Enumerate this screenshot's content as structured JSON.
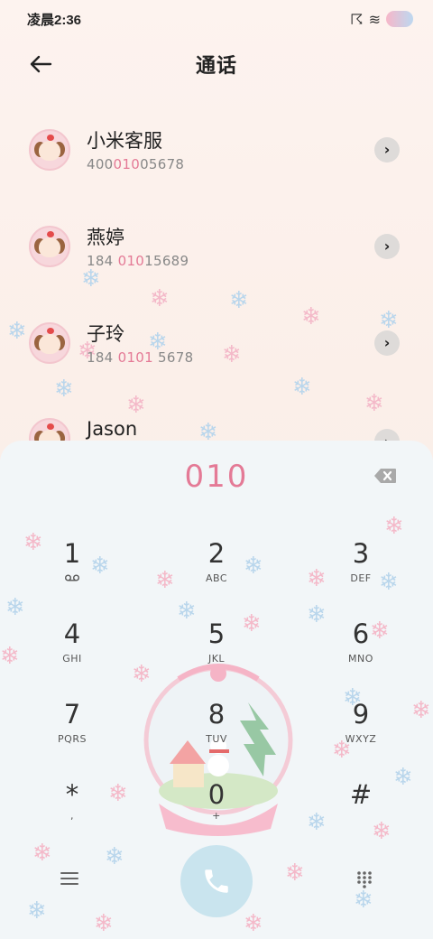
{
  "status_bar": {
    "time": "凌晨2:36"
  },
  "header": {
    "title": "通话",
    "back_icon": "arrow-left-icon"
  },
  "contacts": [
    {
      "name": "小米客服",
      "number_pre": "400",
      "number_hl": "010",
      "number_post": "05678"
    },
    {
      "name": "燕婷",
      "number_pre": "184 ",
      "number_hl": "010",
      "number_post": "15689"
    },
    {
      "name": "子玲",
      "number_pre": "184 ",
      "number_hl": "0101",
      "number_post": " 5678"
    },
    {
      "name": "Jason",
      "number_pre": "",
      "number_hl": "",
      "number_post": ""
    }
  ],
  "dialer": {
    "input": "010",
    "keys": [
      {
        "digit": "1",
        "sub": ""
      },
      {
        "digit": "2",
        "sub": "ABC"
      },
      {
        "digit": "3",
        "sub": "DEF"
      },
      {
        "digit": "4",
        "sub": "GHI"
      },
      {
        "digit": "5",
        "sub": "JKL"
      },
      {
        "digit": "6",
        "sub": "MNO"
      },
      {
        "digit": "7",
        "sub": "PQRS"
      },
      {
        "digit": "8",
        "sub": "TUV"
      },
      {
        "digit": "9",
        "sub": "WXYZ"
      },
      {
        "digit": "*",
        "sub": ","
      },
      {
        "digit": "0",
        "sub": "+"
      },
      {
        "digit": "#",
        "sub": ""
      }
    ]
  },
  "colors": {
    "accent_pink": "#e47a96",
    "call_button": "#c9e4ee",
    "dialpad_bg": "#f2f6f8"
  }
}
